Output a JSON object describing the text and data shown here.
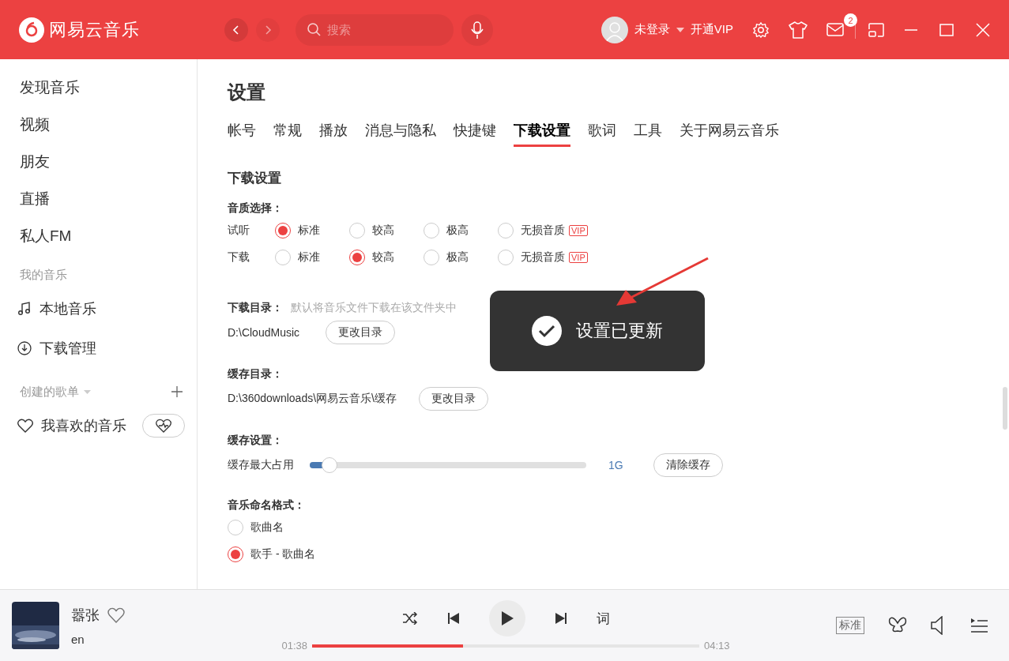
{
  "app": {
    "name": "网易云音乐"
  },
  "header": {
    "search": {
      "placeholder": "搜索"
    },
    "user": "未登录",
    "vip": "开通VIP",
    "mail_count": "2"
  },
  "sidebar": {
    "items": [
      {
        "label": "发现音乐"
      },
      {
        "label": "视频"
      },
      {
        "label": "朋友"
      },
      {
        "label": "直播"
      },
      {
        "label": "私人FM"
      }
    ],
    "my_music_title": "我的音乐",
    "my_music": [
      {
        "label": "本地音乐",
        "kind": "note"
      },
      {
        "label": "下载管理",
        "kind": "download"
      }
    ],
    "playlists_title": "创建的歌单",
    "playlists": [
      {
        "label": "我喜欢的音乐"
      }
    ]
  },
  "settings": {
    "title": "设置",
    "tabs": [
      {
        "label": "帐号",
        "selected": false
      },
      {
        "label": "常规",
        "selected": false
      },
      {
        "label": "播放",
        "selected": false
      },
      {
        "label": "消息与隐私",
        "selected": false
      },
      {
        "label": "快捷键",
        "selected": false
      },
      {
        "label": "下载设置",
        "selected": true
      },
      {
        "label": "歌词",
        "selected": false
      },
      {
        "label": "工具",
        "selected": false
      },
      {
        "label": "关于网易云音乐",
        "selected": false
      }
    ],
    "section_title": "下载设置",
    "quality": {
      "label": "音质选择：",
      "rows": [
        {
          "label": "试听",
          "options": [
            {
              "label": "标准",
              "selected": true
            },
            {
              "label": "较高",
              "selected": false
            },
            {
              "label": "极高",
              "selected": false
            },
            {
              "label": "无损音质",
              "selected": false,
              "badge": "VIP"
            }
          ]
        },
        {
          "label": "下载",
          "options": [
            {
              "label": "标准",
              "selected": false
            },
            {
              "label": "较高",
              "selected": true
            },
            {
              "label": "极高",
              "selected": false
            },
            {
              "label": "无损音质",
              "selected": false,
              "badge": "VIP"
            }
          ]
        }
      ]
    },
    "download_dir": {
      "label": "下载目录：",
      "hint": "默认将音乐文件下载在该文件夹中",
      "path": "D:\\CloudMusic",
      "button": "更改目录"
    },
    "cache_dir": {
      "label": "缓存目录：",
      "path": "D:\\360downloads\\网易云音乐\\缓存",
      "button": "更改目录"
    },
    "cache": {
      "label": "缓存设置：",
      "slider_label": "缓存最大占用",
      "level": 0.07,
      "value": "1G",
      "button": "清除缓存"
    },
    "naming": {
      "label": "音乐命名格式：",
      "options": [
        {
          "label": "歌曲名",
          "selected": false
        },
        {
          "label": "歌手 - 歌曲名",
          "selected": true
        }
      ]
    }
  },
  "toast": {
    "message": "设置已更新"
  },
  "player": {
    "title": "嚣张",
    "artist": "en",
    "elapsed": "01:38",
    "total": "04:13",
    "level": 0.39,
    "lyrics": "词",
    "quality": "标准"
  }
}
